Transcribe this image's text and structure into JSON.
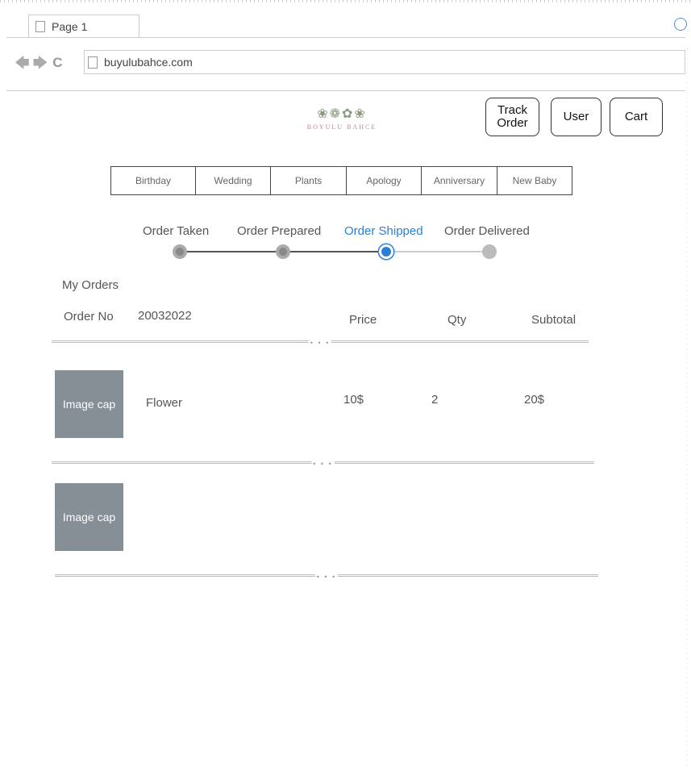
{
  "browser": {
    "tab_title": "Page 1",
    "url": "buyulubahce.com"
  },
  "header": {
    "logo_text": "BOYULU BAHCE",
    "logo_mark": "❀❁✿❀",
    "buttons": {
      "track": "Track Order",
      "user": "User",
      "cart": "Cart"
    }
  },
  "categories": [
    "Birthday",
    "Wedding",
    "Plants",
    "Apology",
    "Anniversary",
    "New Baby"
  ],
  "order_status": {
    "steps": [
      "Order Taken",
      "Order Prepared",
      "Order Shipped",
      "Order Delivered"
    ],
    "current_index": 2,
    "active_color": "#2a7fd4"
  },
  "orders": {
    "heading": "My Orders",
    "order_no_label": "Order No",
    "order_no": "20032022",
    "columns": {
      "price": "Price",
      "qty": "Qty",
      "subtotal": "Subtotal"
    },
    "items": [
      {
        "image_caption": "Image cap",
        "name": "Flower",
        "price": "10$",
        "qty": "2",
        "subtotal": "20$"
      },
      {
        "image_caption": "Image cap",
        "name": "",
        "price": "",
        "qty": "",
        "subtotal": ""
      }
    ],
    "divider_dots": "• • •"
  }
}
